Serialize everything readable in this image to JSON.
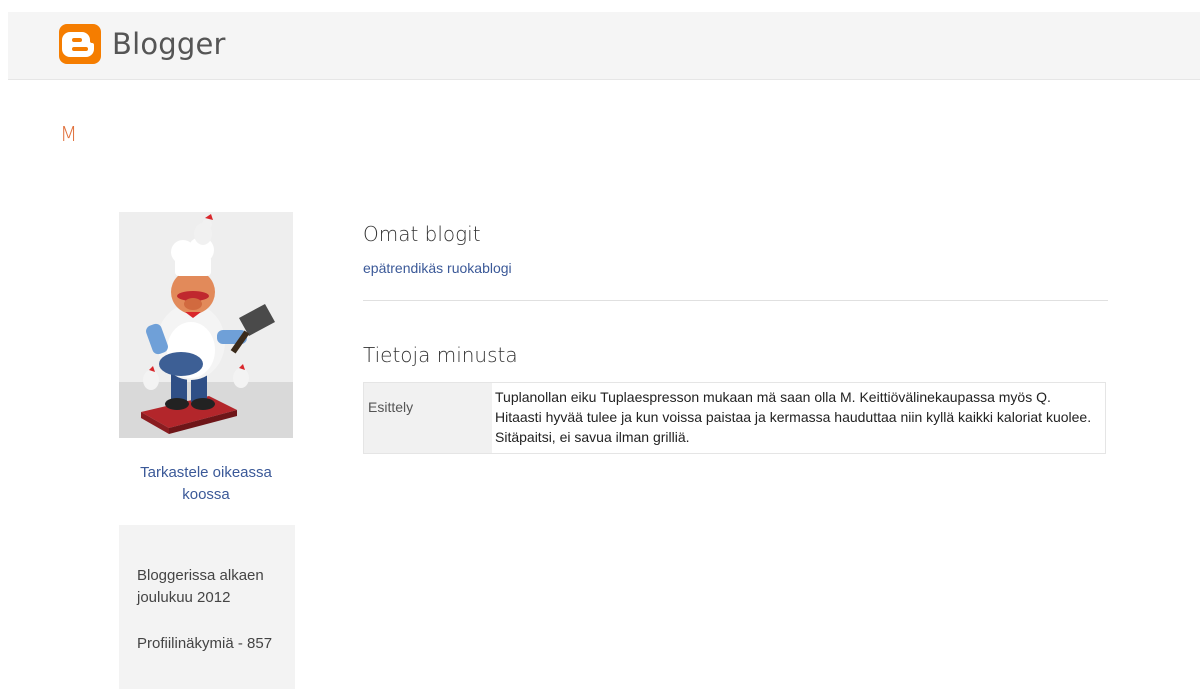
{
  "header": {
    "brand": "Blogger",
    "logo_icon": "blogger-logo-icon",
    "accent": "#f57d00"
  },
  "profile": {
    "name": "M",
    "photo_icon": "chef-figurine-photo",
    "full_size_link": "Tarkastele oikeassa koossa",
    "stats": {
      "member_since": "Bloggerissa alkaen joulukuu 2012",
      "profile_views": "Profiilinäkymiä - 857"
    }
  },
  "main": {
    "blogs_heading": "Omat blogit",
    "blogs": [
      {
        "title": "epätrendikäs ruokablogi"
      }
    ],
    "about_heading": "Tietoja minusta",
    "about_rows": [
      {
        "label": "Esittely",
        "value": "Tuplanollan eiku Tuplaespresson mukaan mä saan olla M. Keittiövälinekaupassa myös Q. Hitaasti hyvää tulee ja kun voissa paistaa ja kermassa hauduttaa niin kyllä kaikki kaloriat kuolee. Sitäpaitsi, ei savua ilman grilliä."
      }
    ]
  },
  "colors": {
    "link": "#3b5998",
    "name": "#e0703b"
  }
}
